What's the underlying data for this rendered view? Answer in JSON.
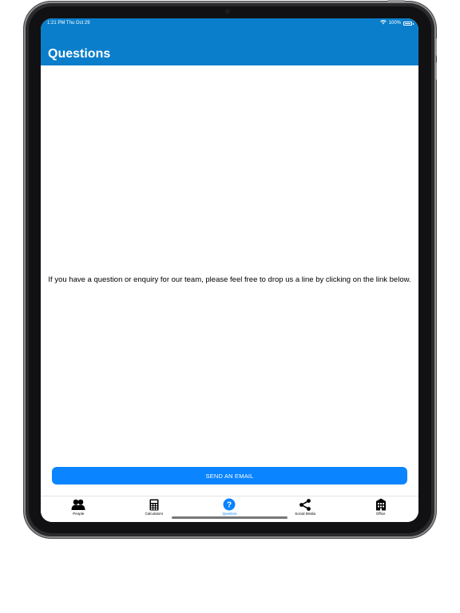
{
  "status_bar": {
    "time": "1:21 PM   Thu Oct 29",
    "battery": "100%"
  },
  "header": {
    "title": "Questions"
  },
  "main": {
    "message": "If you have a question or enquiry for our team, please feel free to drop us a line by clicking on the link below.",
    "send_button_label": "SEND AN EMAIL"
  },
  "tabbar": {
    "tabs": [
      {
        "label": "People",
        "icon": "people-icon",
        "active": false
      },
      {
        "label": "Calculators",
        "icon": "calculator-icon",
        "active": false
      },
      {
        "label": "Question",
        "icon": "question-icon",
        "active": true
      },
      {
        "label": "Social Media",
        "icon": "share-icon",
        "active": false
      },
      {
        "label": "Office",
        "icon": "office-building-icon",
        "active": false
      }
    ]
  },
  "colors": {
    "header_bg": "#0a7ecb",
    "accent": "#0a84ff"
  }
}
